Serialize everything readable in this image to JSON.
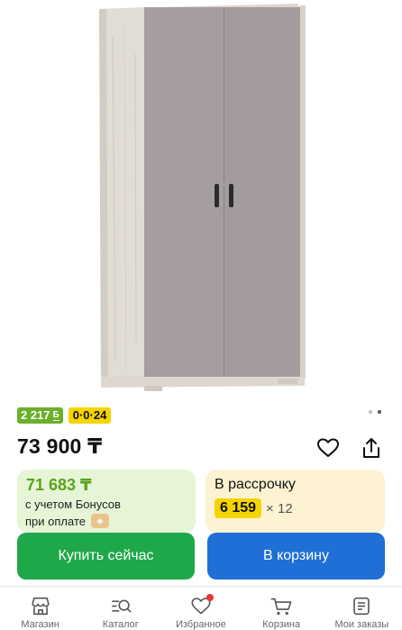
{
  "product": {
    "image_alt": "wardrobe-image"
  },
  "badges": {
    "bonus": "2 217",
    "bonus_symbol": "Б",
    "installment_plan": "0·0·24"
  },
  "gallery": {
    "dots_count": 2,
    "active_index": 1
  },
  "price": {
    "main": "73 900 ₸"
  },
  "bonus_card": {
    "price": "71 683 ₸",
    "note_line1": "с учетом Бонусов",
    "note_line2": "при оплате"
  },
  "installment_card": {
    "title": "В рассрочку",
    "amount": "6 159",
    "multiplier": "× 12"
  },
  "actions": {
    "buy_now": "Купить сейчас",
    "add_to_cart": "В корзину"
  },
  "bottom_nav": {
    "items": [
      {
        "label": "Магазин",
        "icon": "store-icon"
      },
      {
        "label": "Каталог",
        "icon": "catalog-search-icon"
      },
      {
        "label": "Избранное",
        "icon": "heart-icon"
      },
      {
        "label": "Корзина",
        "icon": "cart-icon"
      },
      {
        "label": "Мои заказы",
        "icon": "orders-icon"
      }
    ]
  },
  "colors": {
    "green": "#1ea84a",
    "blue": "#1f6fd6",
    "bonus_green": "#6ab02a",
    "yellow": "#f5d400"
  }
}
